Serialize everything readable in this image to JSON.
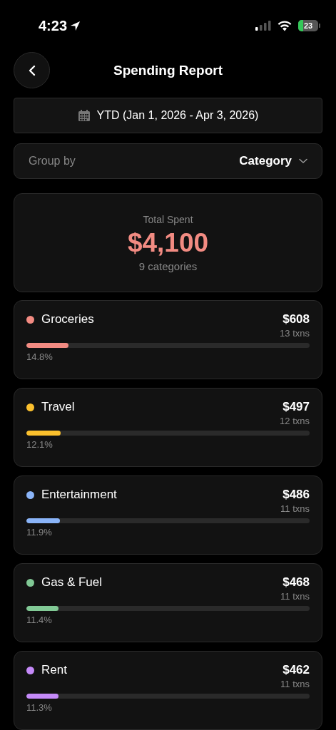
{
  "status_bar": {
    "time": "4:23",
    "battery": "23"
  },
  "header": {
    "title": "Spending Report"
  },
  "date_range": {
    "label": "YTD (Jan 1, 2026 - Apr 3, 2026)"
  },
  "group_by": {
    "label": "Group by",
    "value": "Category"
  },
  "summary": {
    "label": "Total Spent",
    "total": "$4,100",
    "count": "9 categories"
  },
  "categories": [
    {
      "name": "Groceries",
      "color": "#f28b82",
      "amount": "$608",
      "txns": "13 txns",
      "level": 0.148,
      "percent": "14.8%"
    },
    {
      "name": "Travel",
      "color": "#fbc02d",
      "amount": "$497",
      "txns": "12 txns",
      "level": 0.121,
      "percent": "12.1%"
    },
    {
      "name": "Entertainment",
      "color": "#8ab4f8",
      "amount": "$486",
      "txns": "11 txns",
      "level": 0.119,
      "percent": "11.9%"
    },
    {
      "name": "Gas & Fuel",
      "color": "#81c995",
      "amount": "$468",
      "txns": "11 txns",
      "level": 0.114,
      "percent": "11.4%"
    },
    {
      "name": "Rent",
      "color": "#c58af9",
      "amount": "$462",
      "txns": "11 txns",
      "level": 0.113,
      "percent": "11.3%"
    }
  ]
}
